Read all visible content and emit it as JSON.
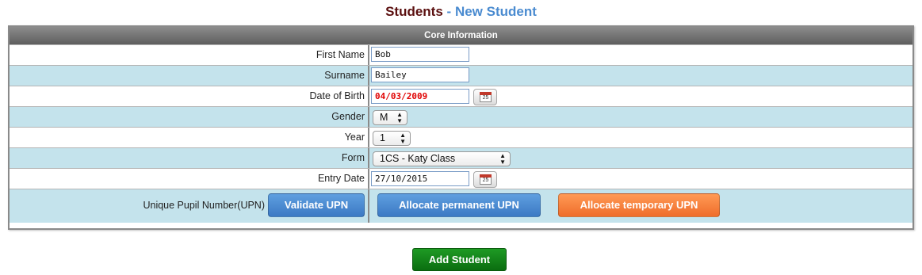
{
  "title": {
    "section": "Students",
    "separator": "-",
    "page": "New Student"
  },
  "form": {
    "header": "Core Information",
    "first_name": {
      "label": "First Name",
      "value": "Bob"
    },
    "surname": {
      "label": "Surname",
      "value": "Bailey"
    },
    "dob": {
      "label": "Date of Birth",
      "value": "04/03/2009",
      "calendar_day": "25"
    },
    "gender": {
      "label": "Gender",
      "selected": "M"
    },
    "year": {
      "label": "Year",
      "selected": "1"
    },
    "form_class": {
      "label": "Form",
      "selected": "1CS - Katy Class"
    },
    "entry_date": {
      "label": "Entry Date",
      "value": "27/10/2015",
      "calendar_day": "25"
    },
    "upn": {
      "label": "Unique Pupil Number(UPN)",
      "validate": "Validate UPN",
      "allocate_permanent": "Allocate permanent UPN",
      "allocate_temporary": "Allocate temporary UPN"
    }
  },
  "actions": {
    "add_student": "Add Student"
  },
  "colors": {
    "title_dark": "#5b1010",
    "title_accent": "#4a8bd0",
    "row_alt": "#c4e3ec",
    "button_blue": "#4a8bd0",
    "button_orange": "#f47b38",
    "button_green": "#13801a",
    "dob_text": "#e00000"
  }
}
